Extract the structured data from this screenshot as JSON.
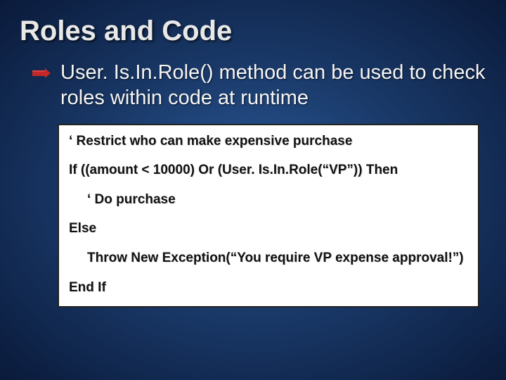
{
  "title": "Roles and Code",
  "body": "User. Is.In.Role() method can be used to check roles within code at runtime",
  "code": {
    "l1": "‘ Restrict who can make expensive purchase",
    "l2": "If ((amount < 10000) Or (User. Is.In.Role(“VP”)) Then",
    "l3": "‘ Do purchase",
    "l4": "Else",
    "l5": "Throw New Exception(“You require VP expense approval!”)",
    "l6": "End If"
  }
}
